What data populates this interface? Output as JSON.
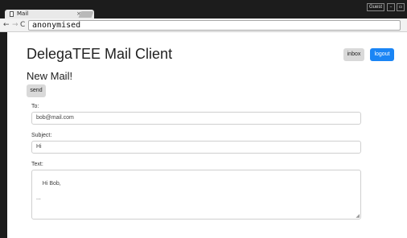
{
  "browser": {
    "tab_title": "Mail",
    "tab_close": "×",
    "guest_label": "Guest",
    "minimize": "–",
    "maximize": "▫",
    "back": "←",
    "forward": "→",
    "reload": "C",
    "url": "anonymised"
  },
  "header": {
    "app_title": "DelegaTEE Mail Client",
    "inbox_label": "inbox",
    "logout_label": "logout",
    "logout_color": "#1a85f5"
  },
  "compose": {
    "title": "New Mail!",
    "send_label": "send",
    "to_label": "To:",
    "to_value": "bob@mail.com",
    "subject_label": "Subject:",
    "subject_value": "Hi",
    "text_label": "Text:",
    "text_value": "Hi Bob,\n\n..."
  }
}
